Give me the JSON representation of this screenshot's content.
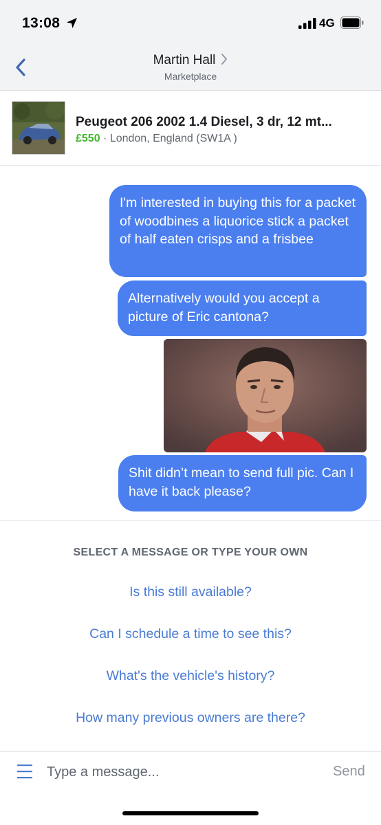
{
  "status_bar": {
    "time": "13:08",
    "network": "4G"
  },
  "header": {
    "title": "Martin Hall",
    "subtitle": "Marketplace"
  },
  "listing": {
    "title": "Peugeot 206 2002 1.4 Diesel, 3 dr, 12 mt...",
    "price": "£550",
    "separator": " · ",
    "location": "London, England (SW1A )"
  },
  "messages": [
    {
      "type": "text",
      "text": "I'm interested in buying this for a packet of woodbines a liquorice stick a packet of half eaten crisps and a frisbee"
    },
    {
      "type": "text",
      "text": "Alternatively would you accept a picture of Eric cantona?"
    },
    {
      "type": "image"
    },
    {
      "type": "text",
      "text": "Shit didn’t mean to send full pic. Can I have it back please?"
    }
  ],
  "suggestions": {
    "header": "SELECT A MESSAGE OR TYPE YOUR OWN",
    "items": [
      "Is this still available?",
      "Can I schedule a time to see this?",
      "What's the vehicle's history?",
      "How many previous owners are there?"
    ]
  },
  "composer": {
    "placeholder": "Type a message...",
    "send_label": "Send"
  },
  "colors": {
    "bubble": "#4b7ff0",
    "link": "#4a7bd3",
    "price": "#42b72a",
    "back": "#4267b2"
  },
  "icons": [
    "location-arrow-icon",
    "signal-icon",
    "battery-icon",
    "back-chevron-icon",
    "chevron-right-icon",
    "menu-icon"
  ]
}
